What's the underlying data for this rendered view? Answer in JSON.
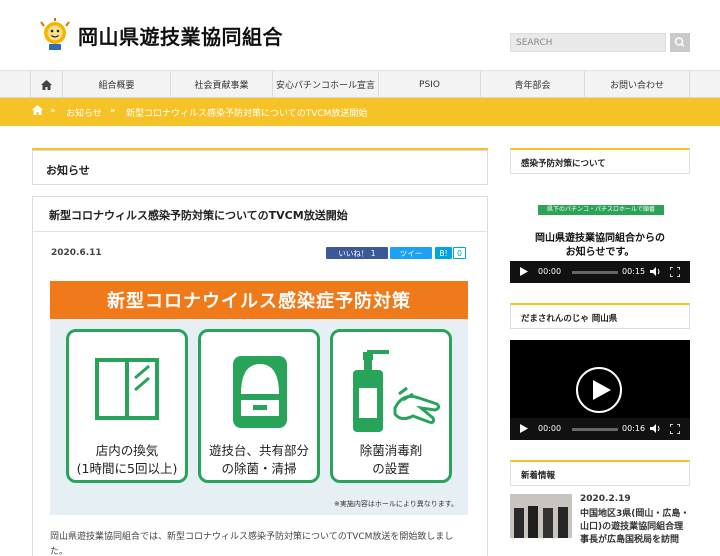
{
  "header": {
    "title": "岡山県遊技業協同組合",
    "search_placeholder": "SEARCH"
  },
  "nav": {
    "items": [
      "組合概要",
      "社会貢献事業",
      "安心パチンコホール宣言",
      "PSIO",
      "青年部会",
      "お問い合わせ"
    ]
  },
  "breadcrumb": {
    "section": "お知らせ",
    "separator": "»",
    "current": "新型コロナウィルス感染予防対策についてのTVCM放送開始"
  },
  "main": {
    "section_title": "お知らせ",
    "post_title": "新型コロナウィルス感染予防対策についてのTVCM放送開始",
    "date": "2020.6.11",
    "share": {
      "like": "いいね！ 1",
      "tweet": "ツイー",
      "hatena_b": "B!",
      "hatena_count": "0"
    },
    "banner": {
      "heading": "新型コロナウイルス感染症予防対策",
      "cards": [
        {
          "line1": "店内の換気",
          "line2": "(1時間に5回以上)"
        },
        {
          "line1": "遊技台、共有部分",
          "line2": "の除菌・清掃"
        },
        {
          "line1": "除菌消毒剤",
          "line2": "の設置"
        }
      ],
      "note": "※実施内容はホールにより異なります。"
    },
    "body": "岡山県遊技業協同組合では、新型コロナウィルス感染予防対策についてのTVCM放送を開始致しました。"
  },
  "sidebar": {
    "widget1": {
      "title": "感染予防対策について",
      "video_tag": "県下のパチンコ・パチスロホールで順番",
      "video_caption_1": "岡山県遊技業協同組合からの",
      "video_caption_2": "お知らせです。",
      "time_current": "00:00",
      "time_total": "00:15"
    },
    "widget2": {
      "title": "だまされんのじゃ 岡山県",
      "time_current": "00:00",
      "time_total": "00:16"
    },
    "widget3": {
      "title": "新着情報",
      "date": "2020.2.19",
      "text": "中国地区3県(岡山・広島・山口)の遊技業協同組合理事長が広島国税局を訪問"
    }
  },
  "colors": {
    "accent": "#f5c227",
    "banner_orange": "#f07a1a",
    "card_green": "#27a45a",
    "facebook": "#3b5998",
    "twitter": "#1da1f2",
    "hatena": "#00a4de"
  }
}
